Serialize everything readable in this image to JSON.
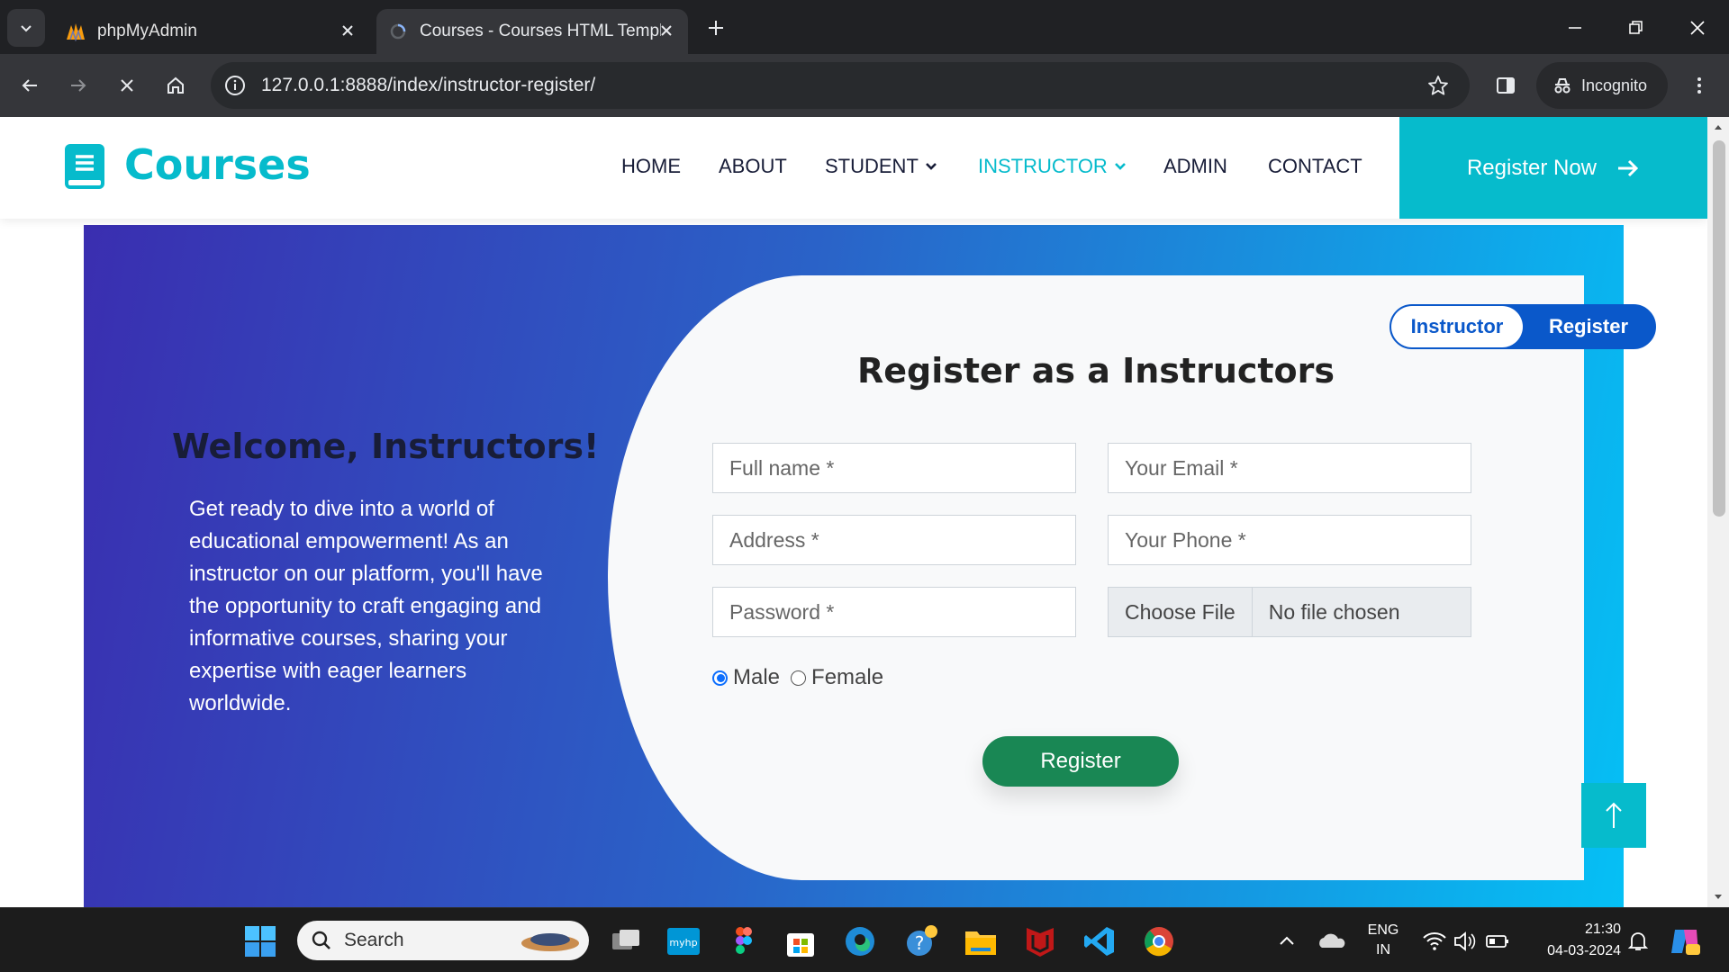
{
  "browser": {
    "tabs": [
      {
        "title": "phpMyAdmin",
        "active": false
      },
      {
        "title": "Courses - Courses HTML Templ",
        "active": true
      }
    ],
    "url": "127.0.0.1:8888/index/instructor-register/",
    "profile": "Incognito"
  },
  "site": {
    "brand": "Courses",
    "nav": [
      {
        "label": "HOME"
      },
      {
        "label": "ABOUT"
      },
      {
        "label": "STUDENT",
        "dropdown": true
      },
      {
        "label": "INSTRUCTOR",
        "dropdown": true,
        "active": true
      },
      {
        "label": "ADMIN"
      },
      {
        "label": "CONTACT"
      }
    ],
    "cta": "Register Now",
    "accent": "#06BBCC"
  },
  "hero": {
    "welcome": "Welcome, Instructors!",
    "paragraph": "Get ready to dive into a world of educational empowerment! As an instructor on our platform, you'll have the opportunity to craft engaging and informative courses, sharing your expertise with eager learners worldwide."
  },
  "form": {
    "toggle": {
      "left": "Instructor",
      "right": "Register"
    },
    "title": "Register as a Instructors",
    "fields": {
      "full_name": "Full name *",
      "email": "Your Email *",
      "address": "Address *",
      "phone": "Your Phone *",
      "password": "Password *"
    },
    "file": {
      "button": "Choose File",
      "status": "No file chosen"
    },
    "gender": {
      "male": "Male",
      "female": "Female",
      "selected": "Male"
    },
    "submit": "Register",
    "submit_color": "#198754"
  },
  "taskbar": {
    "search": "Search",
    "lang": [
      "ENG",
      "IN"
    ],
    "time": "21:30",
    "date": "04-03-2024"
  }
}
